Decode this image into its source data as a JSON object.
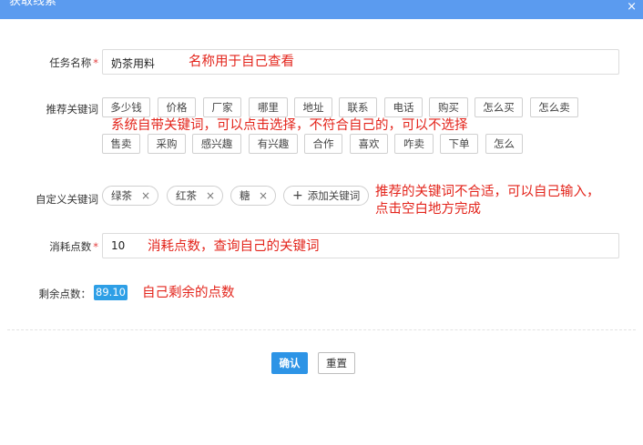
{
  "dialog": {
    "title": "获取线索",
    "close_symbol": "×"
  },
  "form": {
    "task_name": {
      "label": "任务名称",
      "required_mark": "*",
      "value": "奶茶用料",
      "note": "名称用于自己查看"
    },
    "recommended": {
      "label": "推荐关键词",
      "row1": [
        "多少钱",
        "价格",
        "厂家",
        "哪里",
        "地址",
        "联系",
        "电话",
        "购买",
        "怎么买",
        "怎么卖"
      ],
      "row2": [
        "售卖",
        "采购",
        "感兴趣",
        "有兴趣",
        "合作",
        "喜欢",
        "咋卖",
        "下单",
        "怎么"
      ],
      "note": "系统自带关键词，可以点击选择，不符合自己的，可以不选择"
    },
    "custom": {
      "label": "自定义关键词",
      "tags": [
        "绿茶",
        "红茶",
        "糖"
      ],
      "remove_symbol": "×",
      "add_symbol": "+",
      "add_label": "添加关键词",
      "note_line1": "推荐的关键词不合适，可以自己输入，",
      "note_line2": "点击空白地方完成"
    },
    "cost": {
      "label": "消耗点数",
      "required_mark": "*",
      "value": "10",
      "note": "消耗点数，查询自己的关键词"
    },
    "remaining": {
      "label": "剩余点数：",
      "value": "89.10",
      "note": "自己剩余的点数"
    }
  },
  "buttons": {
    "confirm": "确认",
    "reset": "重置"
  }
}
